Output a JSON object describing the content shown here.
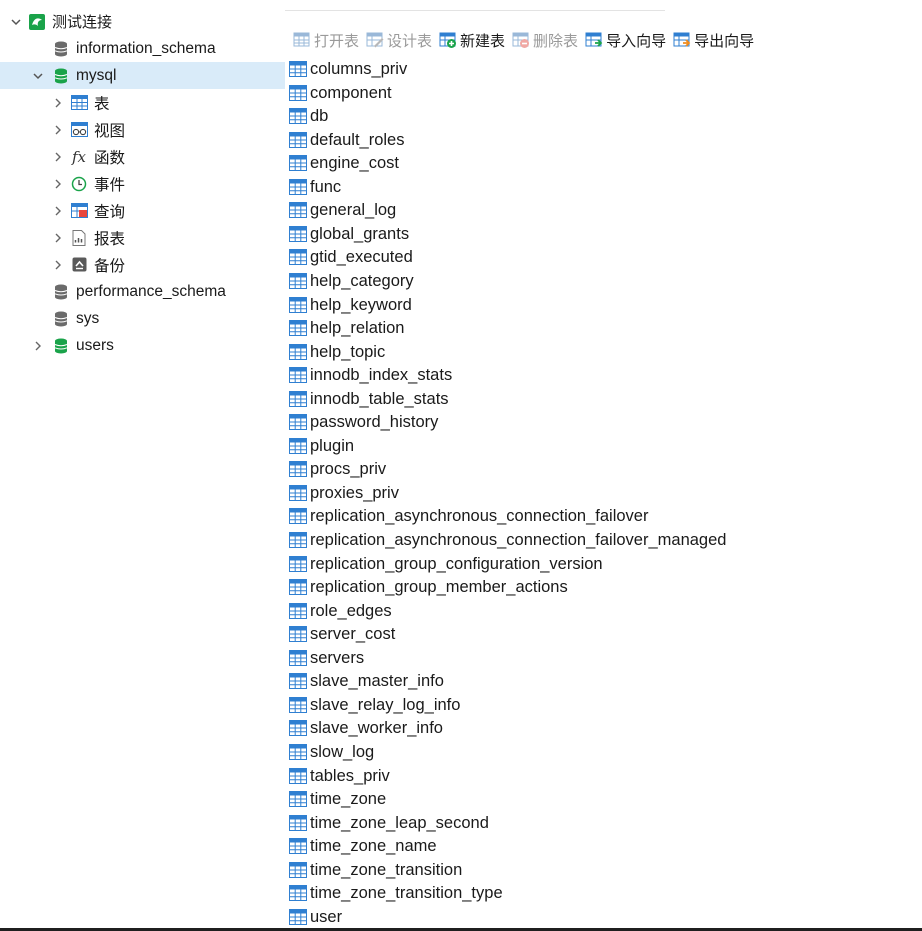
{
  "tree": {
    "connection": "测试连接",
    "databases": [
      {
        "name": "information_schema",
        "selected": false,
        "expandable": false,
        "color": "#6b6b6b"
      },
      {
        "name": "mysql",
        "selected": true,
        "expandable": true,
        "expanded": true,
        "color": "#1aa34a"
      },
      {
        "name": "performance_schema",
        "selected": false,
        "expandable": false,
        "color": "#6b6b6b"
      },
      {
        "name": "sys",
        "selected": false,
        "expandable": false,
        "color": "#6b6b6b"
      },
      {
        "name": "users",
        "selected": false,
        "expandable": true,
        "expanded": false,
        "color": "#1aa34a"
      }
    ],
    "mysql_children": [
      {
        "label": "表",
        "icon": "table-icon"
      },
      {
        "label": "视图",
        "icon": "view-icon"
      },
      {
        "label": "函数",
        "icon": "function-icon",
        "glyph": "fx"
      },
      {
        "label": "事件",
        "icon": "event-clock-icon"
      },
      {
        "label": "查询",
        "icon": "query-icon"
      },
      {
        "label": "报表",
        "icon": "report-icon"
      },
      {
        "label": "备份",
        "icon": "backup-icon"
      }
    ]
  },
  "toolbar": {
    "open_table": "打开表",
    "design_table": "设计表",
    "new_table": "新建表",
    "delete_table": "删除表",
    "import_wizard": "导入向导",
    "export_wizard": "导出向导"
  },
  "tables": [
    "columns_priv",
    "component",
    "db",
    "default_roles",
    "engine_cost",
    "func",
    "general_log",
    "global_grants",
    "gtid_executed",
    "help_category",
    "help_keyword",
    "help_relation",
    "help_topic",
    "innodb_index_stats",
    "innodb_table_stats",
    "password_history",
    "plugin",
    "procs_priv",
    "proxies_priv",
    "replication_asynchronous_connection_failover",
    "replication_asynchronous_connection_failover_managed",
    "replication_group_configuration_version",
    "replication_group_member_actions",
    "role_edges",
    "server_cost",
    "servers",
    "slave_master_info",
    "slave_relay_log_info",
    "slave_worker_info",
    "slow_log",
    "tables_priv",
    "time_zone",
    "time_zone_leap_second",
    "time_zone_name",
    "time_zone_transition",
    "time_zone_transition_type",
    "user"
  ],
  "colors": {
    "selection": "#d9ebf9",
    "db_active": "#1aa34a",
    "db_inactive": "#6b6b6b",
    "table_icon": "#2f7fd1",
    "disabled_text": "#9a9a9a"
  }
}
